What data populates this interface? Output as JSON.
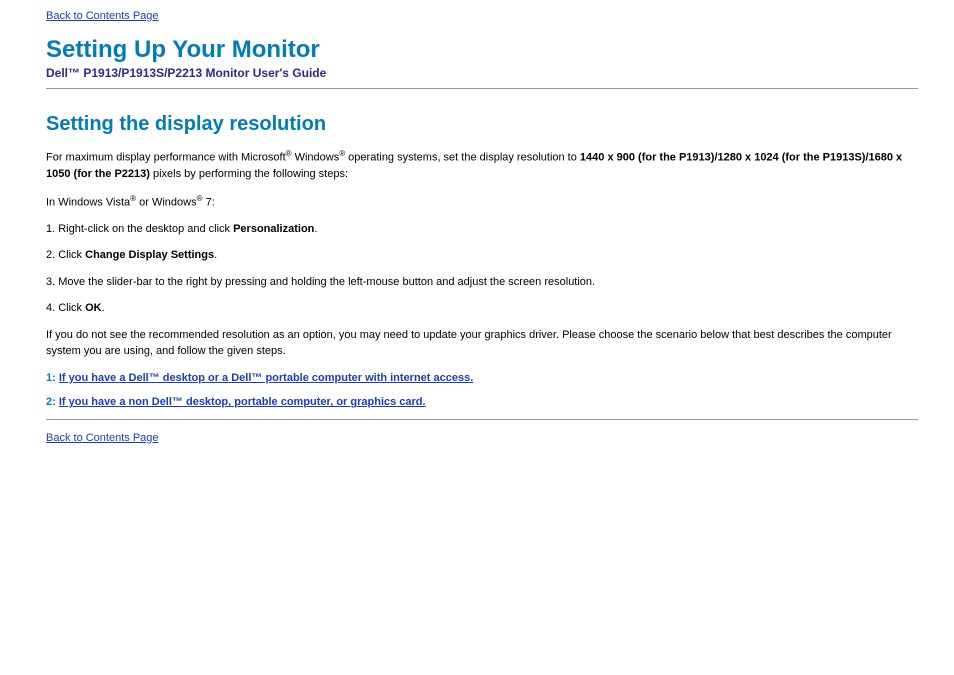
{
  "nav": {
    "back_link": "Back to Contents Page"
  },
  "header": {
    "title": "Setting Up Your Monitor",
    "subtitle": "Dell™ P1913/P1913S/P2213 Monitor User's Guide"
  },
  "section": {
    "heading": "Setting the display resolution",
    "intro_pre": "For maximum display performance with Microsoft",
    "intro_mid": " Windows",
    "intro_post": " operating systems, set the display resolution to ",
    "resolutions": "1440 x 900 (for the P1913)/1280 x 1024 (for the P1913S)/1680 x 1050 (for the P2213)",
    "intro_tail": " pixels by performing the following steps:",
    "os_pre": "In Windows Vista",
    "os_mid": " or Windows",
    "os_post": " 7:",
    "step1_pre": "1. Right-click on the desktop and click ",
    "step1_bold": "Personalization",
    "step1_post": ".",
    "step2_pre": "2. Click ",
    "step2_bold": "Change Display Settings",
    "step2_post": ".",
    "step3": "3. Move the slider-bar to the right by pressing and holding the left-mouse button and adjust the screen resolution.",
    "step4_pre": "4. Click ",
    "step4_bold": "OK",
    "step4_post": ".",
    "note": "If you do not see the recommended resolution as an option, you may need to update your graphics driver. Please choose the scenario below that best describes the computer system you are using, and follow the given steps.",
    "scenario1_num": "1: ",
    "scenario1_link": "If you have a Dell™ desktop or a Dell™ portable computer with internet access.",
    "scenario2_num": "2: ",
    "scenario2_link": "If you have a non Dell™ desktop, portable computer, or graphics card."
  },
  "reg": "®"
}
